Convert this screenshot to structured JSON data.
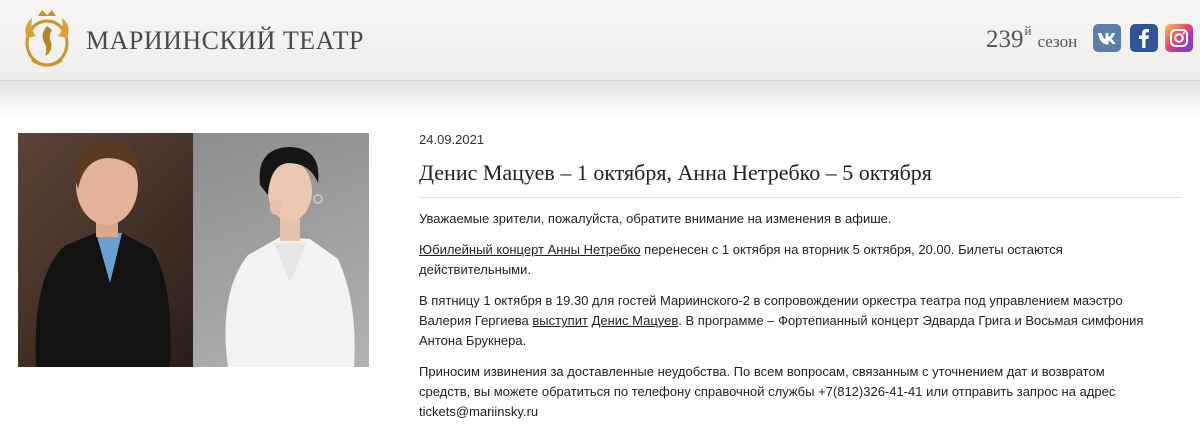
{
  "header": {
    "logo_text": "МАРИИНСКИЙ ТЕАТР",
    "season_number": "239",
    "season_suffix": "й",
    "season_word": "сезон",
    "social": [
      {
        "name": "vk",
        "glyph": "vk"
      },
      {
        "name": "facebook",
        "glyph": "f"
      },
      {
        "name": "instagram",
        "glyph": "instagram-icon"
      }
    ]
  },
  "article": {
    "date": "24.09.2021",
    "title": "Денис Мацуев – 1 октября, Анна Нетребко – 5 октября",
    "p1": "Уважаемые зрители, пожалуйста, обратите внимание на изменения в афише.",
    "p2_link": "Юбилейный концерт Анны Нетребко",
    "p2_rest": " перенесен с 1 октября на вторник 5 октября, 20.00. Билеты остаются действительными.",
    "p3_start": "В пятницу 1 октября в 19.30 для гостей Мариинского-2 в сопровождении оркестра театра под управлением маэстро Валерия Гергиева ",
    "p3_link1": "выступит",
    "p3_space": " ",
    "p3_link2": "Денис Мацуев",
    "p3_end": ". В программе – Фортепианный концерт Эдварда Грига и Восьмая симфония Антона Брукнера.",
    "p4": "Приносим извинения за доставленные неудобства. По всем вопросам, связанным с уточнением дат и возвратом средств, вы можете обратиться по телефону справочной службы +7(812)326-41-41 или отправить запрос на адрес tickets@mariinsky.ru"
  },
  "colors": {
    "header_bg": "#f3f2f0",
    "vk": "#5a7ea5",
    "facebook": "#2f5597",
    "logo_gold": "#c8962e"
  }
}
